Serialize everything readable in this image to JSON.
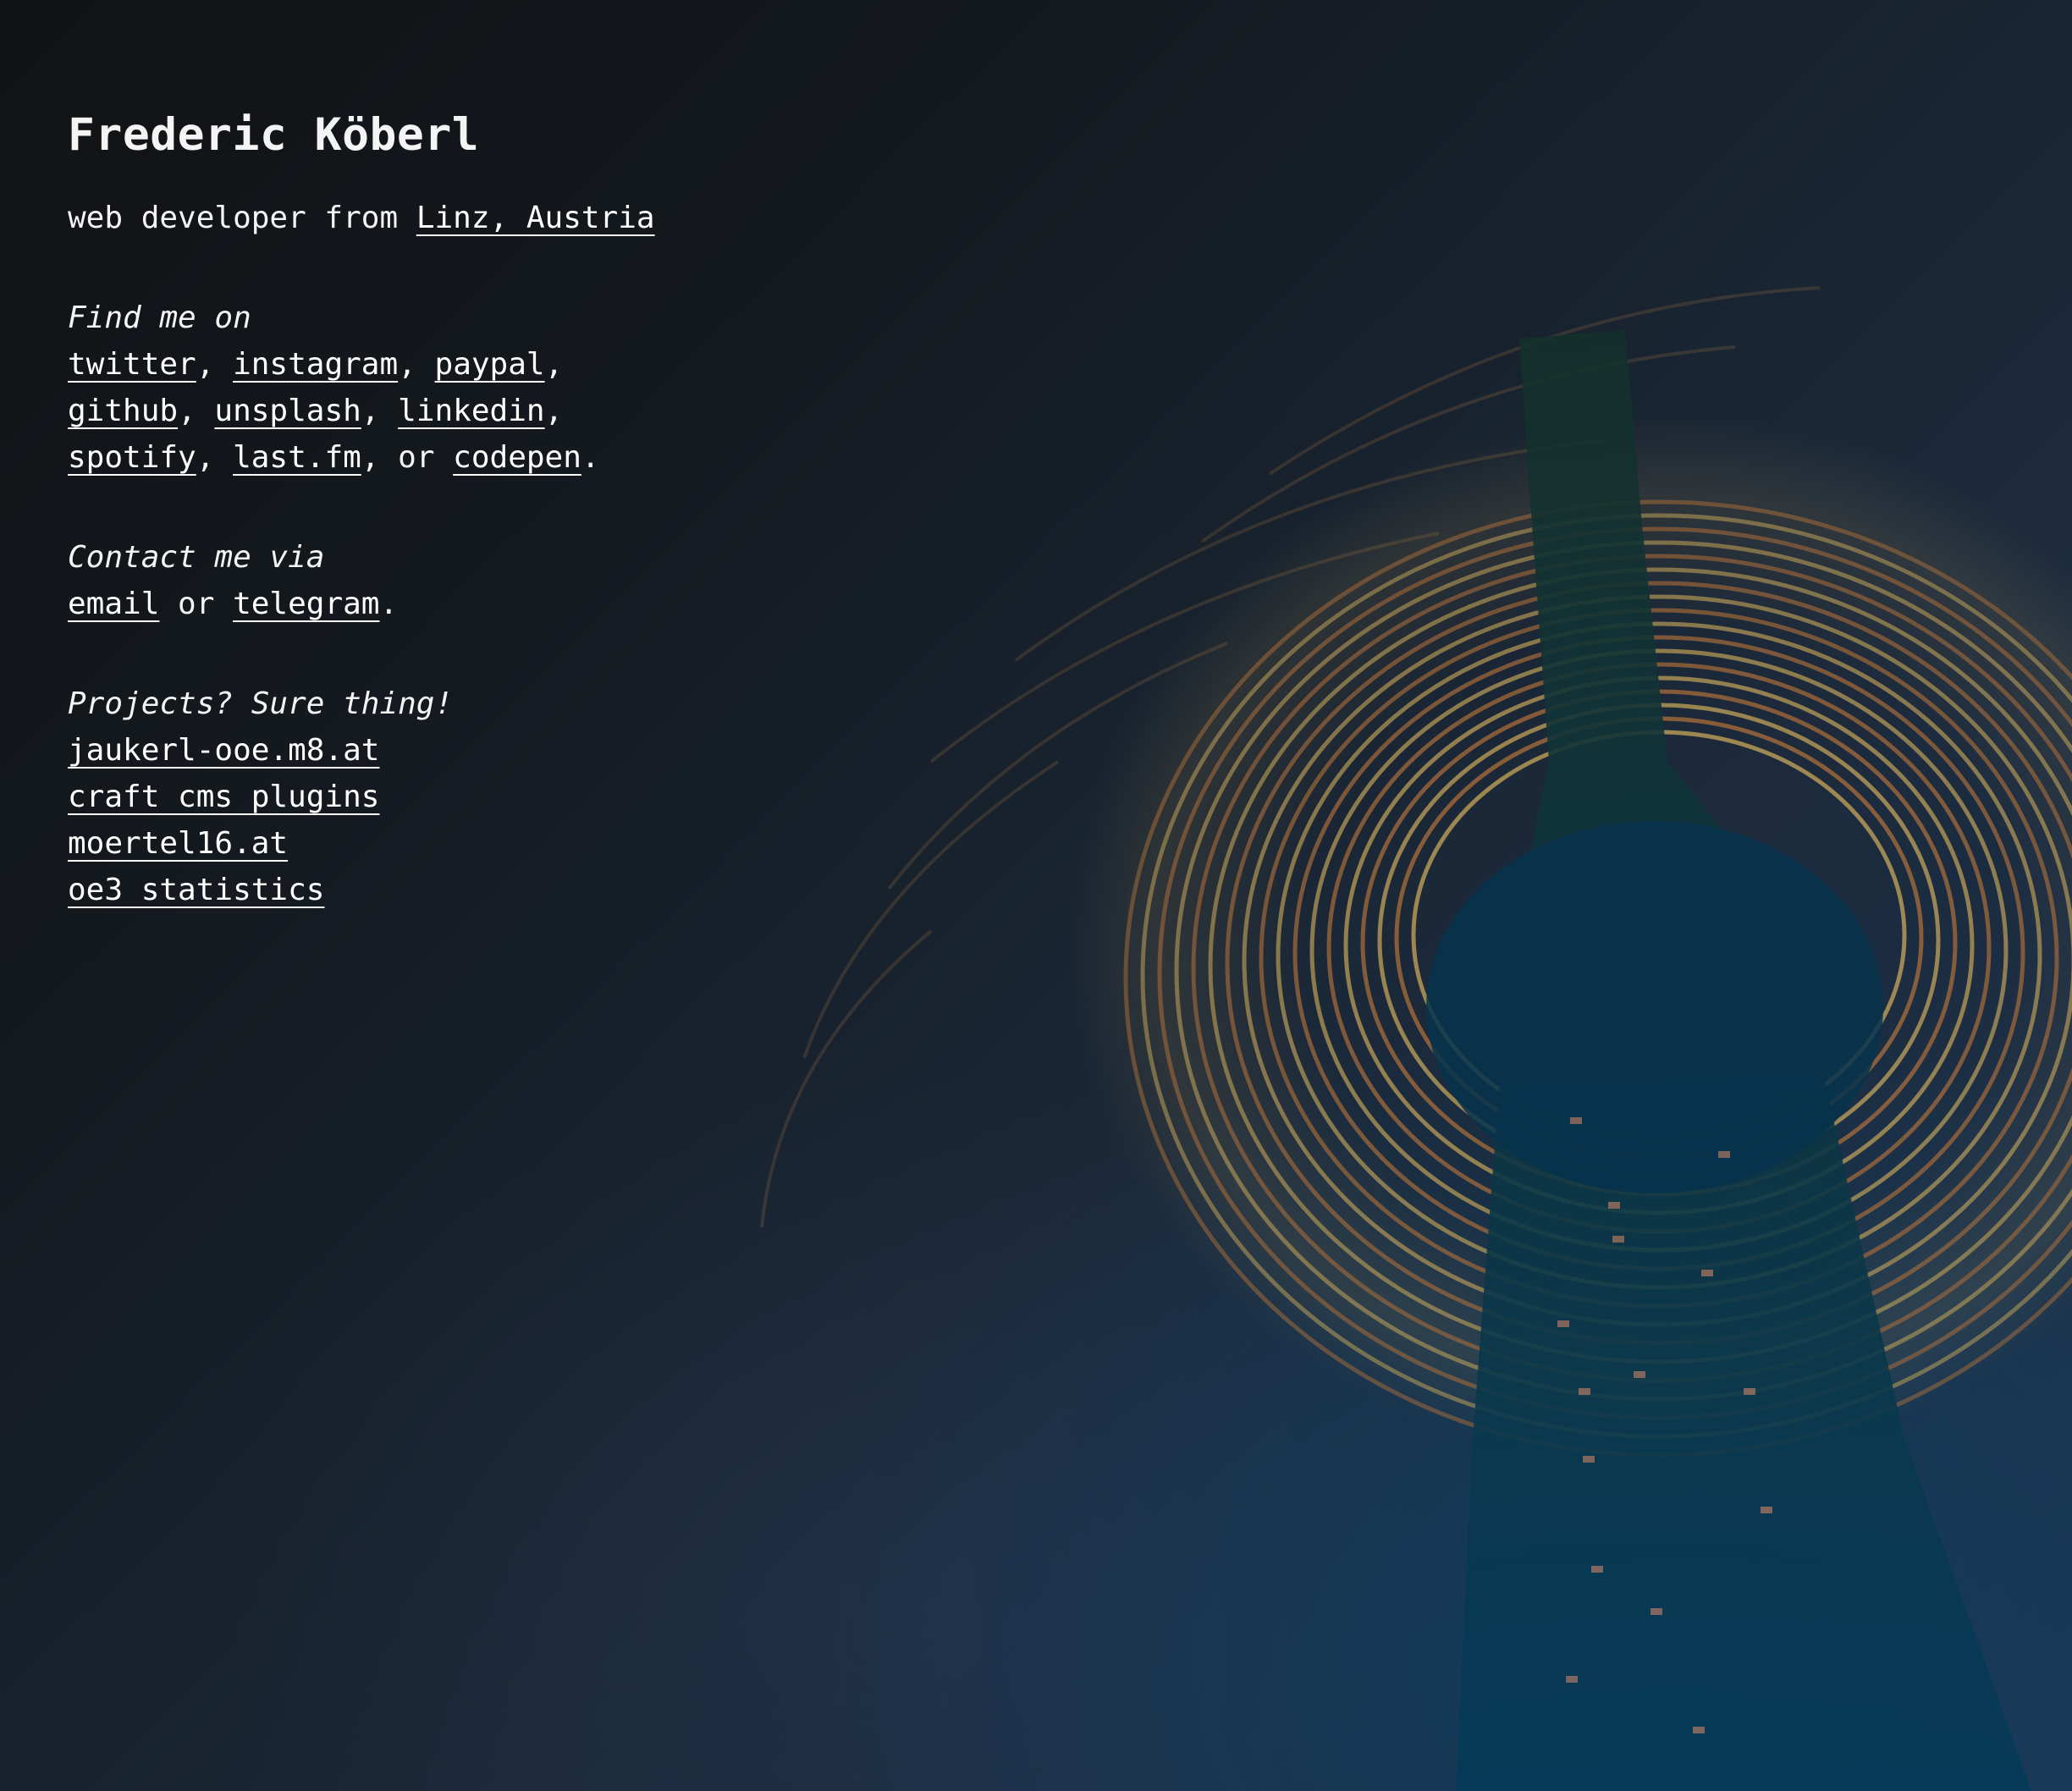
{
  "header": {
    "name": "Frederic Köberl"
  },
  "tagline": {
    "prefix": "web developer from ",
    "location_link": "Linz, Austria"
  },
  "social": {
    "heading": "Find me on",
    "links": {
      "twitter": "twitter",
      "instagram": "instagram",
      "paypal": "paypal",
      "github": "github",
      "unsplash": "unsplash",
      "linkedin": "linkedin",
      "spotify": "spotify",
      "lastfm": "last.fm",
      "codepen": "codepen"
    },
    "separator": ", ",
    "or_text": ", or ",
    "end_period": "."
  },
  "contact": {
    "heading": "Contact me via",
    "email": "email",
    "or_text": " or ",
    "telegram": "telegram",
    "end_period": "."
  },
  "projects": {
    "heading": "Projects? Sure thing!",
    "items": [
      "jaukerl-ooe.m8.at",
      "craft cms plugins",
      "moertel16.at",
      "oe3 statistics"
    ]
  },
  "background": {
    "description_icon": "tower-light-rings-photo",
    "ring_colors": [
      "#c9a75a",
      "#b0703a",
      "#7fa05a"
    ],
    "sky_color": "#1f3550",
    "tower_color": "#0a3a55"
  }
}
